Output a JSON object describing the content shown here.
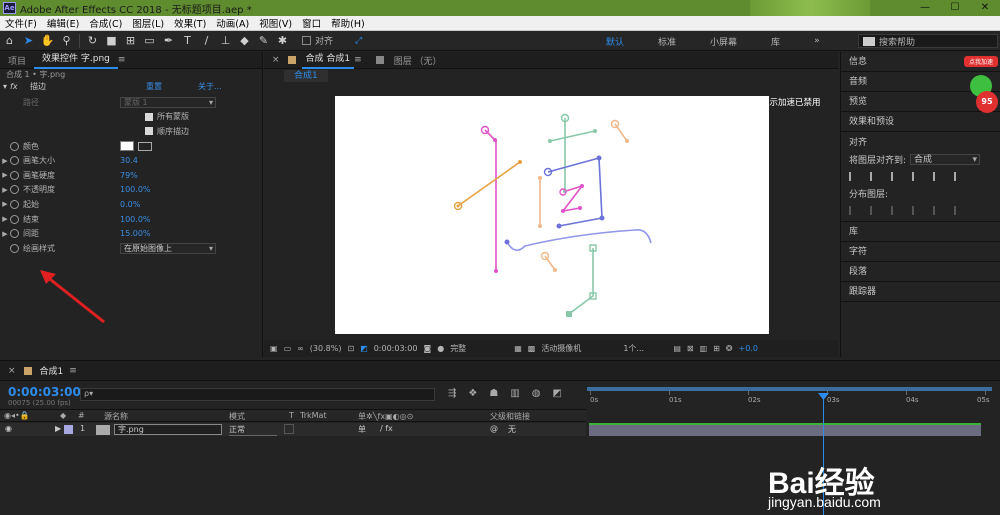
{
  "titlebar": {
    "logo": "Ae",
    "title": "Adobe After Effects CC 2018 - 无标题项目.aep *"
  },
  "menu": [
    "文件(F)",
    "编辑(E)",
    "合成(C)",
    "图层(L)",
    "效果(T)",
    "动画(A)",
    "视图(V)",
    "窗口",
    "帮助(H)"
  ],
  "toolbar": {
    "snap_label": "对齐",
    "workspaces": [
      "默认",
      "标准",
      "小屏幕",
      "库"
    ],
    "search_placeholder": "搜索帮助"
  },
  "left_panel": {
    "tabs": [
      "项目",
      "效果控件 字.png"
    ],
    "breadcrumb": "合成 1 • 字.png",
    "effect": {
      "name": "描边",
      "reset": "重置",
      "about": "关于..."
    },
    "path_label": "路径",
    "path_value": "蒙版 1",
    "checkbox_all_masks": "所有蒙版",
    "checkbox_sequential": "顺序描边",
    "props": [
      {
        "name": "颜色",
        "value": ""
      },
      {
        "name": "画笔大小",
        "value": "30.4"
      },
      {
        "name": "画笔硬度",
        "value": "79%"
      },
      {
        "name": "不透明度",
        "value": "100.0%"
      },
      {
        "name": "起始",
        "value": "0.0%"
      },
      {
        "name": "结束",
        "value": "100.0%"
      },
      {
        "name": "间距",
        "value": "15.00%"
      }
    ],
    "paint_style_label": "绘画样式",
    "paint_style_value": "在原始图像上"
  },
  "comp_panel": {
    "tabs": [
      "合成 合成1",
      "图层 （无）"
    ],
    "subtab": "合成1",
    "gpu_notice": "显示加速已禁用",
    "zoom": "(30.8%)",
    "timecode": "0:00:03:00",
    "quality": "完整",
    "camera": "活动摄像机",
    "views": "1个...",
    "exposure": "+0.0"
  },
  "right_panel": {
    "items_top": [
      "信息",
      "音频",
      "预览",
      "效果和预设"
    ],
    "align": {
      "title": "对齐",
      "align_to_label": "将图层对齐到:",
      "align_to_value": "合成",
      "distribute_label": "分布图层:"
    },
    "items_bottom": [
      "库",
      "字符",
      "段落",
      "跟踪器"
    ],
    "badge_text": "点我加速",
    "badge_num": "95"
  },
  "timeline": {
    "tab": "合成1",
    "timecode": "0:00:03:00",
    "fps": "00075 (25.00 fps)",
    "search_placeholder": "ρ▾",
    "columns": {
      "num": "#",
      "source": "源名称",
      "mode": "模式",
      "t": "T",
      "trkmat": "TrkMat",
      "parent": "父级和链接"
    },
    "layer": {
      "index": "1",
      "name": "字.png",
      "mode": "正常",
      "parent": "无"
    },
    "ruler": [
      "0s",
      "01s",
      "02s",
      "03s",
      "04s",
      "05s"
    ],
    "cti_time_seconds": 3
  },
  "watermark": {
    "brand": "Bai经验",
    "url": "jingyan.baidu.com"
  }
}
